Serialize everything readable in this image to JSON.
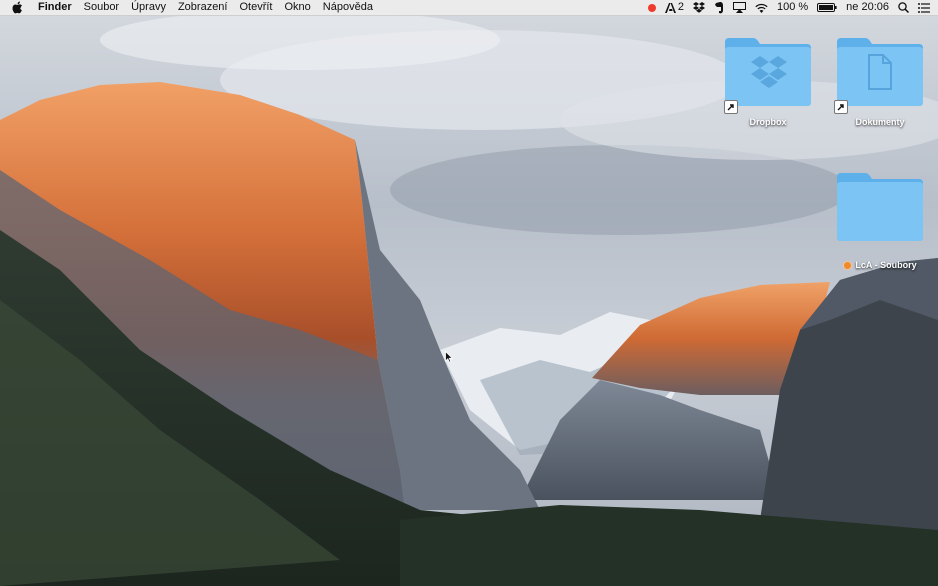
{
  "menubar": {
    "app_name": "Finder",
    "menus": [
      "Soubor",
      "Úpravy",
      "Zobrazení",
      "Otevřít",
      "Okno",
      "Nápověda"
    ],
    "status": {
      "adobe_count": "2",
      "battery": "100 %",
      "clock": "ne 20:06"
    }
  },
  "desktop_icons": [
    {
      "label": "Dropbox",
      "kind": "alias-folder",
      "glyph": "dropbox-icon"
    },
    {
      "label": "Dokumenty",
      "kind": "alias-folder",
      "glyph": "document-icon"
    },
    {
      "label": "LcA - Soubory",
      "kind": "folder",
      "tag_color": "#f08a2c"
    }
  ],
  "colors": {
    "folder": "#7cc4f3",
    "folder_dark": "#5eb0eb",
    "record": "#ef3b2d"
  }
}
